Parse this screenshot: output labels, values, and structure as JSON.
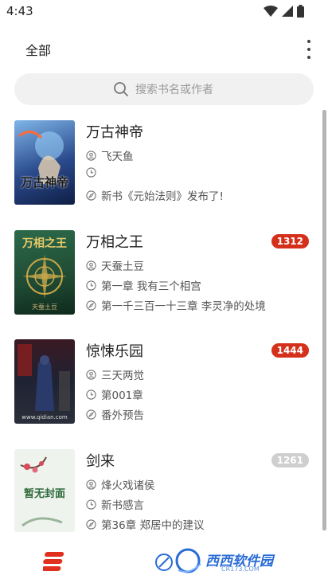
{
  "status": {
    "time": "4:43"
  },
  "header": {
    "title": "全部"
  },
  "search": {
    "placeholder": "搜索书名或作者"
  },
  "books": [
    {
      "title": "万古神帝",
      "author": "飞天鱼",
      "progress": "",
      "latest": "新书《元始法则》发布了!",
      "badge": "",
      "badge_color": "",
      "cover_title": "万古神帝",
      "cover_author": "",
      "cover_bg": "#2a4a8c"
    },
    {
      "title": "万相之王",
      "author": "天蚕土豆",
      "progress": "第一章 我有三个相宫",
      "latest": "第一千三百一十三章 李灵净的处境",
      "badge": "1312",
      "badge_color": "#d4301c",
      "cover_title": "万相之王",
      "cover_author": "天蚕土豆",
      "cover_bg": "#1f4a33"
    },
    {
      "title": "惊悚乐园",
      "author": "三天两觉",
      "progress": "第001章",
      "latest": "番外预告",
      "badge": "1444",
      "badge_color": "#d4301c",
      "cover_title": "",
      "cover_author": "www.qidian.com",
      "cover_bg": "#1e2233"
    },
    {
      "title": "剑来",
      "author": "烽火戏诸侯",
      "progress": "新书感言",
      "latest": "第36章 郑居中的建议",
      "badge": "1261",
      "badge_color": "#cfcfcf",
      "cover_title": "暂无封面",
      "cover_author": "",
      "cover_bg": "#eef3ee"
    }
  ],
  "watermark": {
    "text": "西西软件园",
    "sub": "CR173.COM"
  }
}
